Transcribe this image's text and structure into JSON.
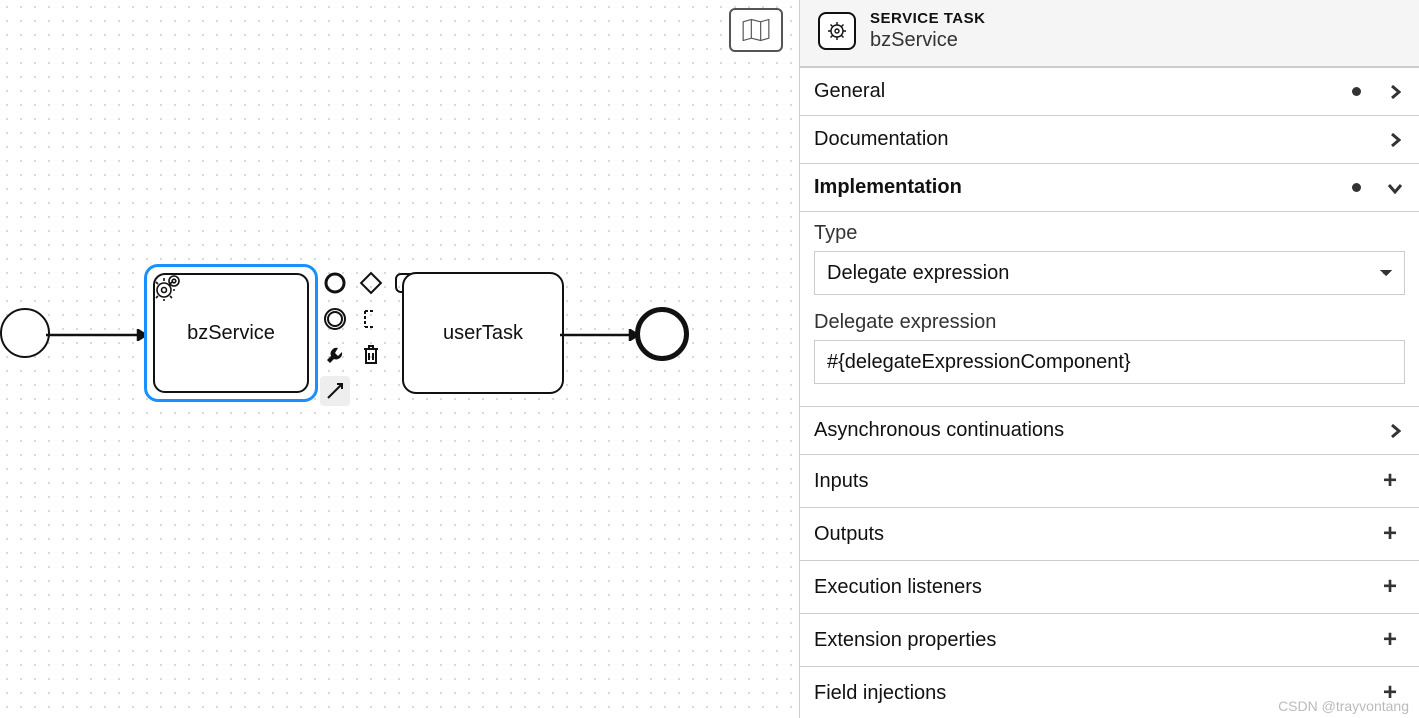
{
  "header": {
    "type_label": "SERVICE TASK",
    "element_name": "bzService"
  },
  "diagram": {
    "start_event": "start-event",
    "service_task": {
      "label": "bzService"
    },
    "user_task": {
      "label": "userTask"
    },
    "end_event": "end-event",
    "palette": {
      "row0": [
        "end-event-icon",
        "gateway-icon",
        "task-icon",
        "call-activity-icon"
      ],
      "row1": [
        "intermediate-event-icon",
        "data-object-icon",
        "",
        "more-icon"
      ],
      "row2": [
        "wrench-icon",
        "trash-icon",
        "",
        "color-icon"
      ],
      "row3": [
        "connect-icon",
        "",
        "",
        ""
      ]
    }
  },
  "sections": {
    "general": {
      "title": "General",
      "has_content": true,
      "open": false
    },
    "documentation": {
      "title": "Documentation",
      "has_content": false,
      "open": false
    },
    "implementation": {
      "title": "Implementation",
      "has_content": true,
      "open": true
    },
    "async": {
      "title": "Asynchronous continuations",
      "has_content": false,
      "open": false
    },
    "inputs": {
      "title": "Inputs"
    },
    "outputs": {
      "title": "Outputs"
    },
    "exec_listeners": {
      "title": "Execution listeners"
    },
    "ext_props": {
      "title": "Extension properties"
    },
    "field_inj": {
      "title": "Field injections"
    }
  },
  "implementation": {
    "type_label": "Type",
    "type_value": "Delegate expression",
    "expr_label": "Delegate expression",
    "expr_value": "#{delegateExpressionComponent}"
  },
  "watermark": "CSDN @trayvontang"
}
